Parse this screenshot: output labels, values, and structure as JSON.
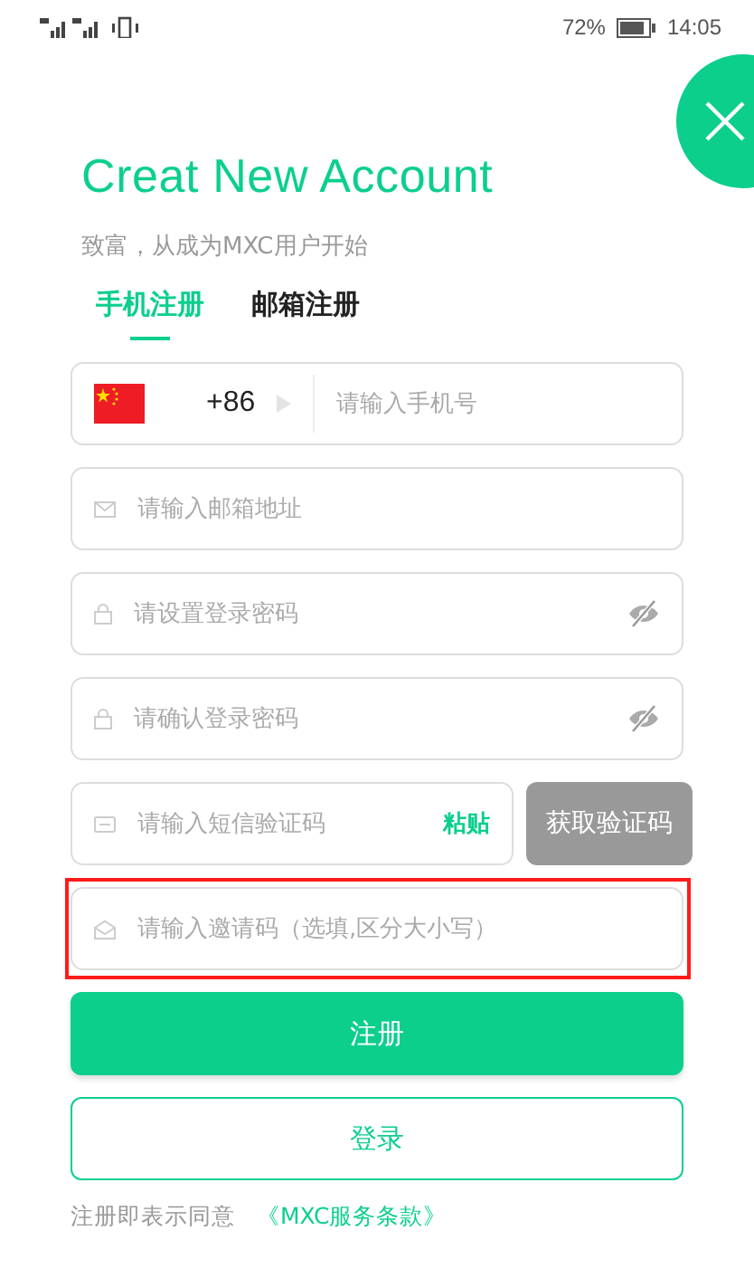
{
  "status_bar": {
    "battery_percent": "72%",
    "time": "14:05"
  },
  "title": "Creat New Account",
  "subtitle": "致富，从成为MXC用户开始",
  "tabs": [
    {
      "label": "手机注册",
      "selected": true
    },
    {
      "label": "邮箱注册",
      "selected": false
    }
  ],
  "fields": [
    {
      "kind": "phone",
      "country_code": "+86",
      "placeholder": "请输入手机号"
    },
    {
      "kind": "email",
      "placeholder": "请输入邮箱地址"
    },
    {
      "kind": "password",
      "placeholder": "请设置登录密码"
    },
    {
      "kind": "password",
      "placeholder": "请确认登录密码"
    },
    {
      "kind": "sms",
      "placeholder": "请输入短信验证码",
      "paste_label": "粘贴",
      "button_label": "获取验证码"
    },
    {
      "kind": "invite",
      "placeholder": "请输入邀请码（选填,区分大小写）",
      "highlighted": true
    }
  ],
  "register_button": "注册",
  "login_button": "登录",
  "terms": {
    "text": "注册即表示同意",
    "link": "《MXC服务条款》"
  }
}
